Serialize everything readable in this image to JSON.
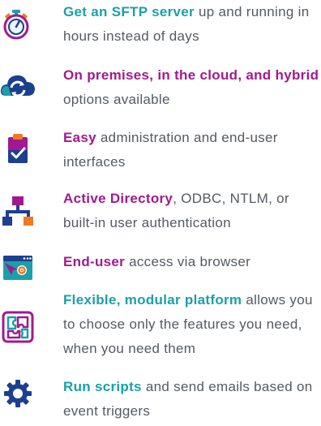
{
  "features": [
    {
      "highlight": "Get an SFTP server",
      "rest": " up and running in hours instead of days",
      "icon": "stopwatch-icon"
    },
    {
      "highlight": "On premises, in the cloud, and hybrid",
      "rest": " options available",
      "icon": "cloud-sync-icon"
    },
    {
      "highlight": "Easy",
      "rest": " administration and end-user interfaces",
      "icon": "clipboard-check-icon"
    },
    {
      "highlight": "Active Directory",
      "rest": ", ODBC, NTLM, or built-in user authentication",
      "icon": "org-chart-icon"
    },
    {
      "highlight": "End-user",
      "rest": " access via browser",
      "icon": "browser-settings-icon"
    },
    {
      "highlight": "Flexible, modular platform",
      "rest": " allows you to choose only the features you need, when you need them",
      "icon": "puzzle-icon"
    },
    {
      "highlight": "Run scripts",
      "rest": " and send emails based on event triggers",
      "icon": "gear-icon"
    }
  ],
  "colors": {
    "teal": "#1aa0a8",
    "magenta": "#a2198f",
    "navy": "#1c3f8f",
    "orange": "#f07a22",
    "text": "#555a60"
  }
}
